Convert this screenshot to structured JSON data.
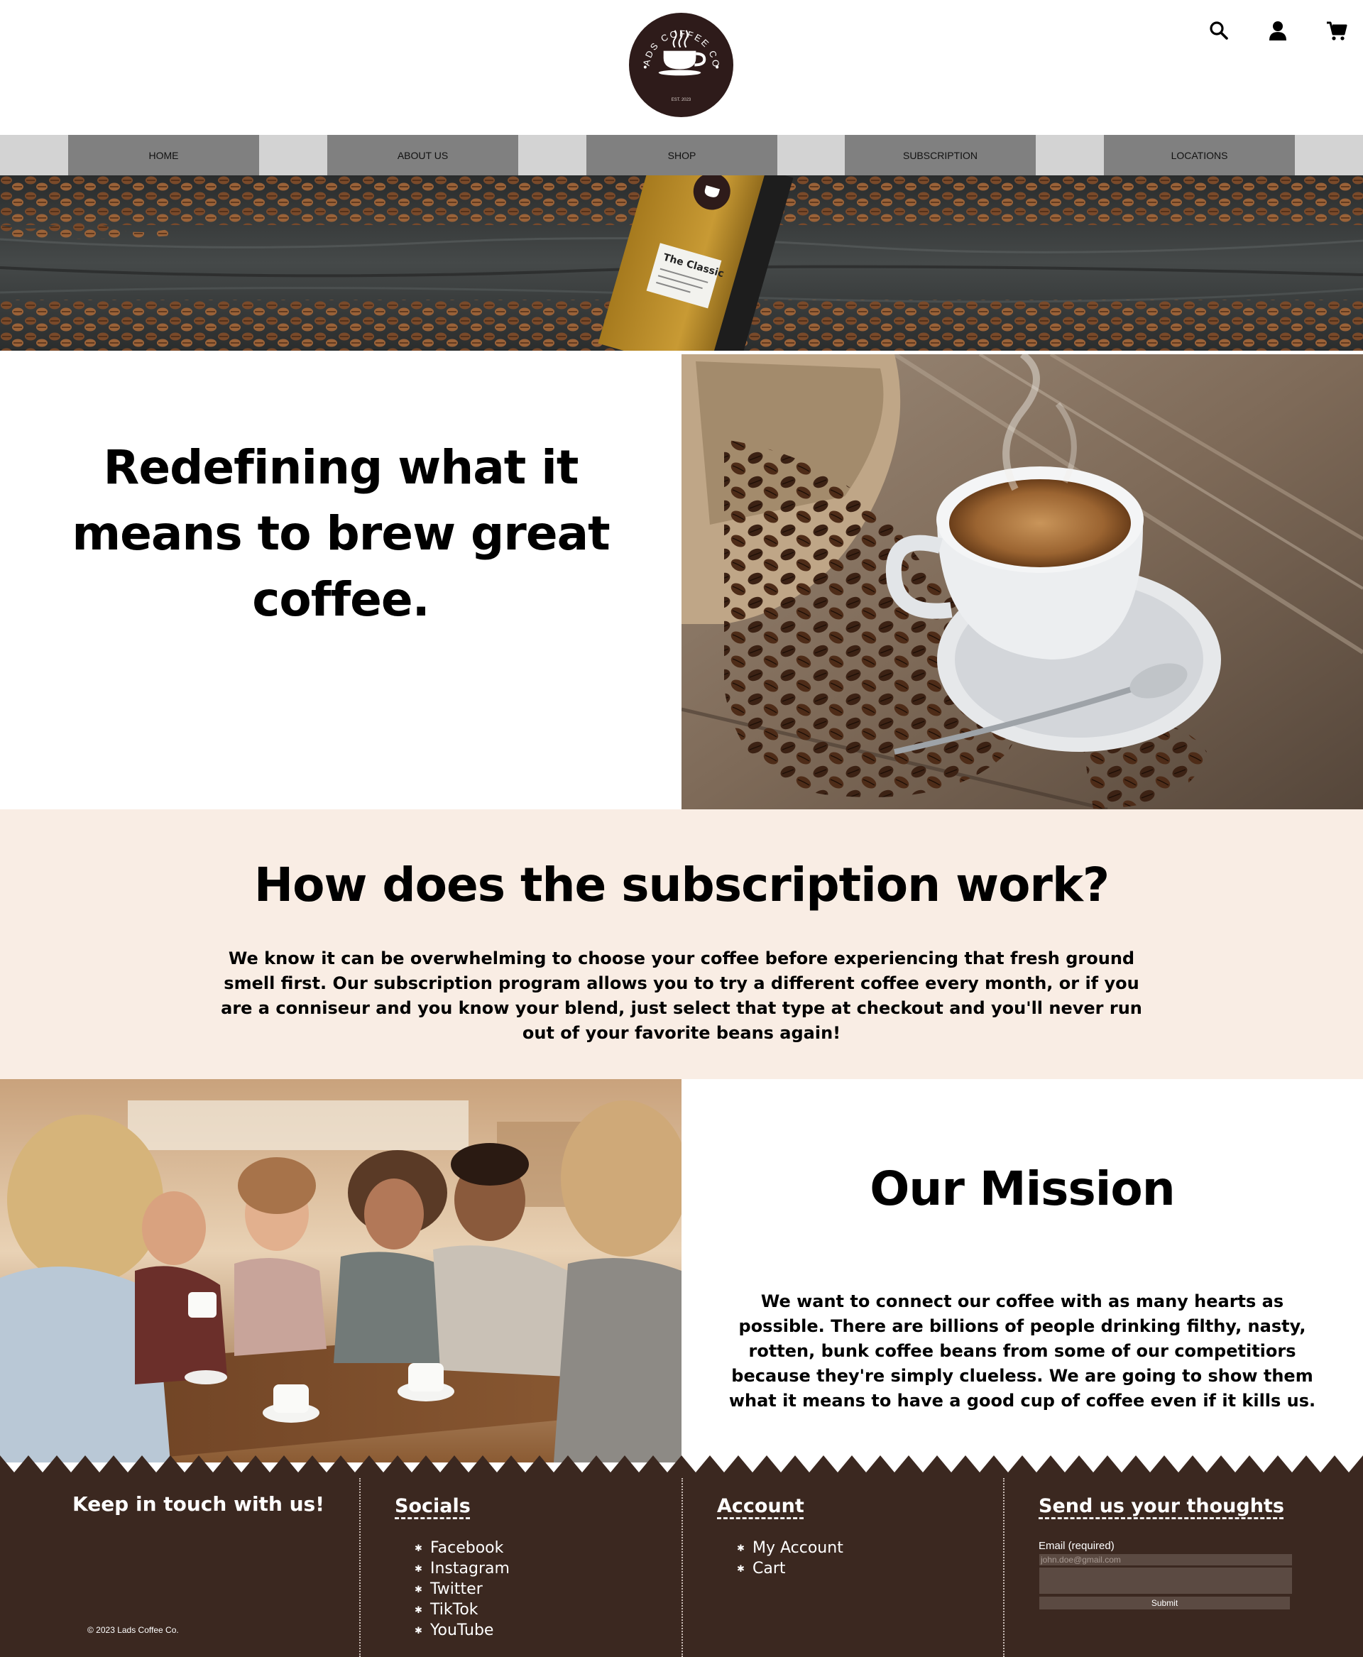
{
  "brand": {
    "logo_ring_text": "LADS COFFEE CO.",
    "logo_est": "EST. 2023",
    "colors": {
      "logo_bg": "#2e1b1a",
      "nav_bg": "#d3d3d3",
      "nav_item_bg": "#808080",
      "subscription_bg": "#f9ede4",
      "footer_bg": "#3b2820"
    }
  },
  "header": {
    "icons": [
      "search-icon",
      "user-icon",
      "cart-icon"
    ]
  },
  "nav": {
    "items": [
      {
        "label": "HOME"
      },
      {
        "label": "ABOUT US"
      },
      {
        "label": "SHOP"
      },
      {
        "label": "SUBSCRIPTION"
      },
      {
        "label": "LOCATIONS"
      }
    ]
  },
  "banner": {
    "bag_label": "The Classic"
  },
  "hero": {
    "title": "Redefining what it means to brew great coffee."
  },
  "subscription": {
    "title": "How does the subscription work?",
    "text": "We know it can be overwhelming to choose your coffee before experiencing that fresh ground smell first. Our subscription program allows you to try a different coffee every month, or if you are a conniseur and you know your blend, just select that type at checkout and you'll never run out of your favorite beans again!"
  },
  "mission": {
    "title": "Our Mission",
    "text": "We want to connect our coffee with as many hearts as possible. There are billions of people drinking filthy, nasty, rotten, bunk coffee beans from some of our competitiors because they're simply clueless. We are going to show them what it means to have a good cup of coffee even if it kills us."
  },
  "footer": {
    "keep_in_touch": "Keep in touch with us!",
    "copyright": "© 2023 Lads Coffee Co.",
    "socials": {
      "heading": "Socials",
      "links": [
        "Facebook",
        "Instagram",
        "Twitter",
        "TikTok",
        "YouTube"
      ]
    },
    "account": {
      "heading": "Account",
      "links": [
        "My Account",
        "Cart"
      ]
    },
    "feedback": {
      "heading": "Send us your thoughts",
      "email_label": "Email (required)",
      "email_placeholder": "john.doe@gmail.com",
      "submit_label": "Submit"
    }
  }
}
